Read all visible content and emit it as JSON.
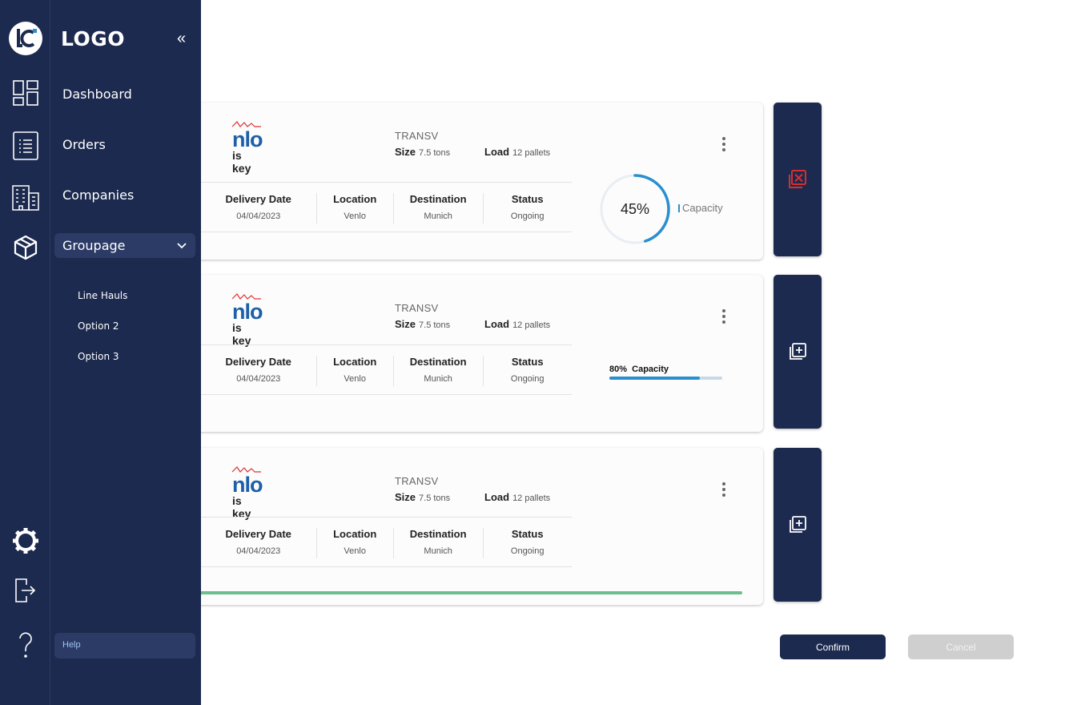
{
  "sidebar": {
    "logo_text": "LOGO",
    "logo_mark": "lc",
    "collapse_icon": "«",
    "nav": {
      "dashboard": "Dashboard",
      "orders": "Orders",
      "companies": "Companies",
      "groupage": "Groupage"
    },
    "sub_items": [
      "Line Hauls",
      "Option 2",
      "Option 3"
    ],
    "help": "Help"
  },
  "cards": [
    {
      "brand": "nlo",
      "brand_tagline": "is key",
      "carrier": "TRANSV",
      "size_label": "Size",
      "size_value": "7.5 tons",
      "load_label": "Load",
      "load_value": "12 pallets",
      "columns": [
        {
          "header": "Delivery Date",
          "value": "04/04/2023"
        },
        {
          "header": "Location",
          "value": "Venlo"
        },
        {
          "header": "Destination",
          "value": "Munich"
        },
        {
          "header": "Status",
          "value": "Ongoing"
        }
      ],
      "capacity_style": "ring",
      "capacity_percent": 45,
      "capacity_text": "45%",
      "capacity_label": "Capacity",
      "side_action": "remove-icon"
    },
    {
      "brand": "nlo",
      "brand_tagline": "is key",
      "carrier": "TRANSV",
      "size_label": "Size",
      "size_value": "7.5 tons",
      "load_label": "Load",
      "load_value": "12 pallets",
      "columns": [
        {
          "header": "Delivery Date",
          "value": "04/04/2023"
        },
        {
          "header": "Location",
          "value": "Venlo"
        },
        {
          "header": "Destination",
          "value": "Munich"
        },
        {
          "header": "Status",
          "value": "Ongoing"
        }
      ],
      "capacity_style": "bar",
      "capacity_percent": 80,
      "capacity_text": "80%",
      "capacity_label": "Capacity",
      "side_action": "add-icon"
    },
    {
      "brand": "nlo",
      "brand_tagline": "is key",
      "carrier": "TRANSV",
      "size_label": "Size",
      "size_value": "7.5 tons",
      "load_label": "Load",
      "load_value": "12 pallets",
      "columns": [
        {
          "header": "Delivery Date",
          "value": "04/04/2023"
        },
        {
          "header": "Location",
          "value": "Venlo"
        },
        {
          "header": "Destination",
          "value": "Munich"
        },
        {
          "header": "Status",
          "value": "Ongoing"
        }
      ],
      "capacity_style": "line",
      "side_action": "add-icon"
    }
  ],
  "actions": {
    "confirm": "Confirm",
    "cancel": "Cancel"
  },
  "colors": {
    "navy": "#1c2a4f",
    "accent_blue": "#2a8fcf",
    "remove_red": "#d32f2f",
    "progress_green": "#6abf8c"
  }
}
